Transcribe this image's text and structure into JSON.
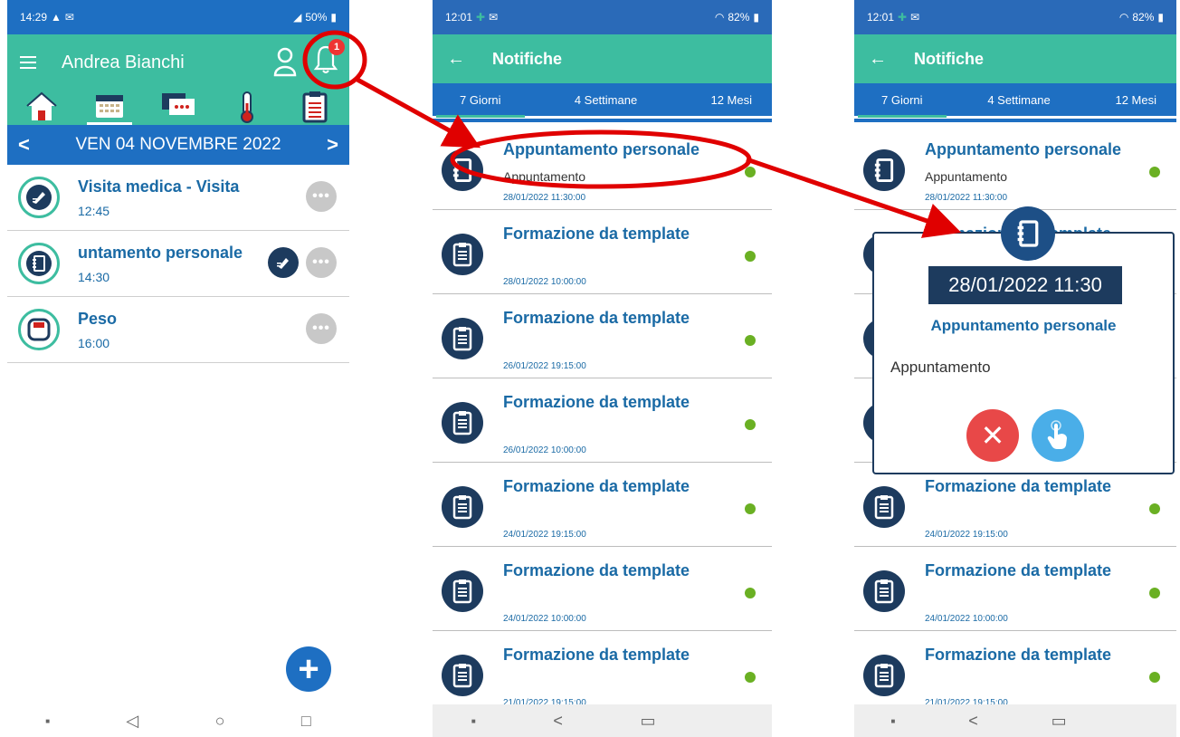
{
  "colors": {
    "teal": "#3dbda0",
    "blue": "#1e6fc2",
    "navy": "#1d3b5e",
    "title_blue": "#1a6aa5",
    "green_dot": "#6ab023",
    "annotation_red": "#e00000"
  },
  "phone1": {
    "status": {
      "time": "14:29",
      "battery": "50%"
    },
    "header": {
      "title": "Andrea Bianchi",
      "notification_count": "1"
    },
    "tabs": [
      "home-icon",
      "calendar-icon",
      "chat-icon",
      "thermometer-icon",
      "clipboard-icon"
    ],
    "date_label": "VEN 04 NOVEMBRE 2022",
    "items": [
      {
        "title": "Visita medica - Visita",
        "time": "12:45",
        "icon": "pen-icon"
      },
      {
        "title": "untamento personale",
        "time": "14:30",
        "icon": "notebook-icon"
      },
      {
        "title": "Peso",
        "time": "16:00",
        "icon": "scale-icon"
      }
    ],
    "more_label": "•••",
    "fab_label": "+"
  },
  "phone2": {
    "status": {
      "time": "12:01",
      "battery": "82%"
    },
    "header": {
      "back": "←",
      "title": "Notifiche"
    },
    "tabs": [
      {
        "label": "7 Giorni",
        "active": true
      },
      {
        "label": "4 Settimane"
      },
      {
        "label": "12 Mesi"
      }
    ],
    "items": [
      {
        "title": "Appuntamento personale",
        "subtitle": "Appuntamento",
        "date": "28/01/2022 11:30:00",
        "icon": "notebook-icon"
      },
      {
        "title": "Formazione da template",
        "subtitle": "",
        "date": "28/01/2022 10:00:00",
        "icon": "clipboard-icon"
      },
      {
        "title": "Formazione da template",
        "subtitle": "",
        "date": "26/01/2022 19:15:00",
        "icon": "clipboard-icon"
      },
      {
        "title": "Formazione da template",
        "subtitle": "",
        "date": "26/01/2022 10:00:00",
        "icon": "clipboard-icon"
      },
      {
        "title": "Formazione da template",
        "subtitle": "",
        "date": "24/01/2022 19:15:00",
        "icon": "clipboard-icon"
      },
      {
        "title": "Formazione da template",
        "subtitle": "",
        "date": "24/01/2022 10:00:00",
        "icon": "clipboard-icon"
      },
      {
        "title": "Formazione da template",
        "subtitle": "",
        "date": "21/01/2022 19:15:00",
        "icon": "clipboard-icon"
      }
    ]
  },
  "phone3": {
    "status": {
      "time": "12:01",
      "battery": "82%"
    },
    "header": {
      "back": "←",
      "title": "Notifiche"
    },
    "tabs": [
      {
        "label": "7 Giorni",
        "active": true
      },
      {
        "label": "4 Settimane"
      },
      {
        "label": "12 Mesi"
      }
    ],
    "items": [
      {
        "title": "Appuntamento personale",
        "subtitle": "Appuntamento",
        "date": "28/01/2022 11:30:00",
        "icon": "notebook-icon"
      },
      {
        "title": "Formazione da template",
        "subtitle": "",
        "date": "28/01/2022 10:00:00",
        "icon": "clipboard-icon"
      },
      {
        "title": "Formazione da template",
        "subtitle": "",
        "date": "26/01/2022 19:15:00",
        "icon": "clipboard-icon"
      },
      {
        "title": "Formazione da template",
        "subtitle": "",
        "date": "26/01/2022 10:00:00",
        "icon": "clipboard-icon"
      },
      {
        "title": "Formazione da template",
        "subtitle": "",
        "date": "24/01/2022 19:15:00",
        "icon": "clipboard-icon"
      },
      {
        "title": "Formazione da template",
        "subtitle": "",
        "date": "24/01/2022 10:00:00",
        "icon": "clipboard-icon"
      },
      {
        "title": "Formazione da template",
        "subtitle": "",
        "date": "21/01/2022 19:15:00",
        "icon": "clipboard-icon"
      }
    ],
    "popup": {
      "datetime": "28/01/2022 11:30",
      "title": "Appuntamento personale",
      "description": "Appuntamento",
      "cancel_label": "✕"
    }
  }
}
